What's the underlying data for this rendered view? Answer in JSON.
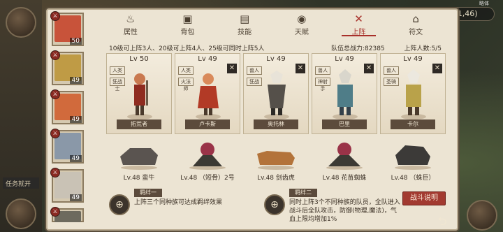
{
  "hud": {
    "score": "(141,46)",
    "top_text": "略体"
  },
  "map": {
    "side_tag": "任务就开"
  },
  "tabs": [
    {
      "label": "属性",
      "icon": "flame-icon"
    },
    {
      "label": "背包",
      "icon": "backpack-icon"
    },
    {
      "label": "技能",
      "icon": "book-icon"
    },
    {
      "label": "天赋",
      "icon": "eye-icon"
    },
    {
      "label": "上阵",
      "icon": "crossed-swords-icon",
      "active": true
    },
    {
      "label": "符文",
      "icon": "rune-icon"
    }
  ],
  "info": {
    "unlock_text": "10级可上阵3人、20级可上阵4人、25级可同时上阵5人",
    "team_power": "队伍总战力:82385",
    "deploy_count": "上阵人数:5/5"
  },
  "roster": [
    {
      "level": "50",
      "badge": "A",
      "face_color": "#c8533a"
    },
    {
      "level": "49",
      "badge": "A",
      "face_color": "#bf9b45"
    },
    {
      "level": "49",
      "badge": "A",
      "face_color": "#d16a3c"
    },
    {
      "level": "49",
      "badge": "A",
      "face_color": "#8a98a8"
    },
    {
      "level": "49",
      "badge": "A",
      "face_color": "#c9c2b5"
    },
    {
      "level": "",
      "badge": "A",
      "face_color": "#6d6a5e"
    }
  ],
  "heroes": [
    {
      "level": "Lv 50",
      "tags": [
        "人类",
        "狂战士"
      ],
      "name": "拓荒者",
      "closable": false,
      "color": "#8f2c20"
    },
    {
      "level": "Lv 49",
      "tags": [
        "人类",
        "火法师"
      ],
      "name": "卢卡斯",
      "closable": true,
      "color": "#b23a26"
    },
    {
      "level": "Lv 49",
      "tags": [
        "兽人",
        "狂战"
      ],
      "name": "奥托林",
      "closable": true,
      "color": "#55504a"
    },
    {
      "level": "Lv 49",
      "tags": [
        "兽人",
        "神射手"
      ],
      "name": "巴里",
      "closable": true,
      "color": "#4f7d88"
    },
    {
      "level": "Lv 49",
      "tags": [
        "兽人",
        "圣骑"
      ],
      "name": "卡尔",
      "closable": true,
      "color": "#b9a24a"
    }
  ],
  "pets": [
    {
      "label": "Lv.48 蛮牛",
      "color": "#5a5450"
    },
    {
      "label": "Lv.48 （短骨）2号",
      "color": "#9a3348"
    },
    {
      "label": "Lv.48 剑齿虎",
      "color": "#b3733a"
    },
    {
      "label": "Lv.48 花苗蜘蛛",
      "color": "#9a3348"
    },
    {
      "label": "Lv.48 （蛛巨）",
      "color": "#3c3a38"
    }
  ],
  "bonds": [
    {
      "title": "羁绊一",
      "desc": "上阵三个同种族可达成羁绊效果",
      "icon": "crosshair-icon"
    },
    {
      "title": "羁绊二",
      "desc": "同时上阵3个不同种族的队员，全队进入战斗后全队攻击，防御(物理,魔法)，气血上限均增加1%",
      "icon": "crosshair-icon"
    }
  ],
  "buttons": {
    "battle_explain": "战斗说明",
    "close": "⮌"
  }
}
